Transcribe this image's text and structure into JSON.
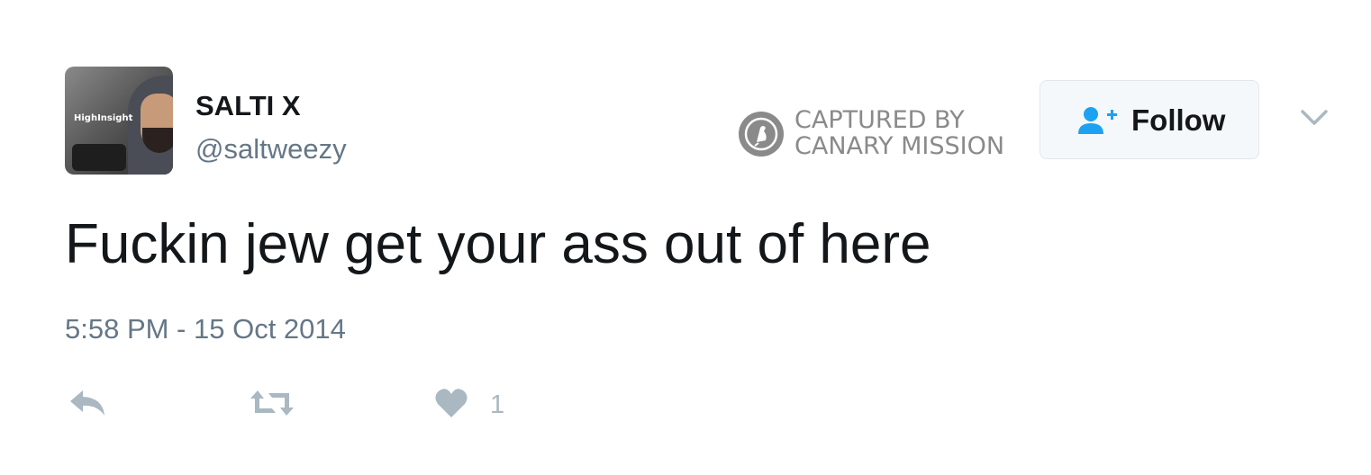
{
  "author": {
    "display_name": "SALTI X",
    "handle": "@saltweezy",
    "avatar_brand_text": "HighInsight"
  },
  "watermark": {
    "line1": "CAPTURED BY",
    "line2": "CANARY MISSION",
    "icon": "canary-bird-icon"
  },
  "follow_button": {
    "label": "Follow",
    "icon": "add-user-icon"
  },
  "menu": {
    "icon": "chevron-down-icon"
  },
  "tweet": {
    "text": "Fuckin jew get your ass out of here",
    "timestamp": "5:58 PM - 15 Oct 2014"
  },
  "actions": {
    "reply_icon": "reply-icon",
    "retweet_icon": "retweet-icon",
    "like_icon": "heart-icon",
    "like_count": "1"
  },
  "colors": {
    "text_primary": "#14171a",
    "text_secondary": "#657786",
    "follow_icon_blue": "#1da1f2",
    "action_gray": "#aab8c2",
    "watermark_gray": "#8a8a8a",
    "button_bg": "#f5f8fa",
    "button_border": "#e1e8ed"
  }
}
